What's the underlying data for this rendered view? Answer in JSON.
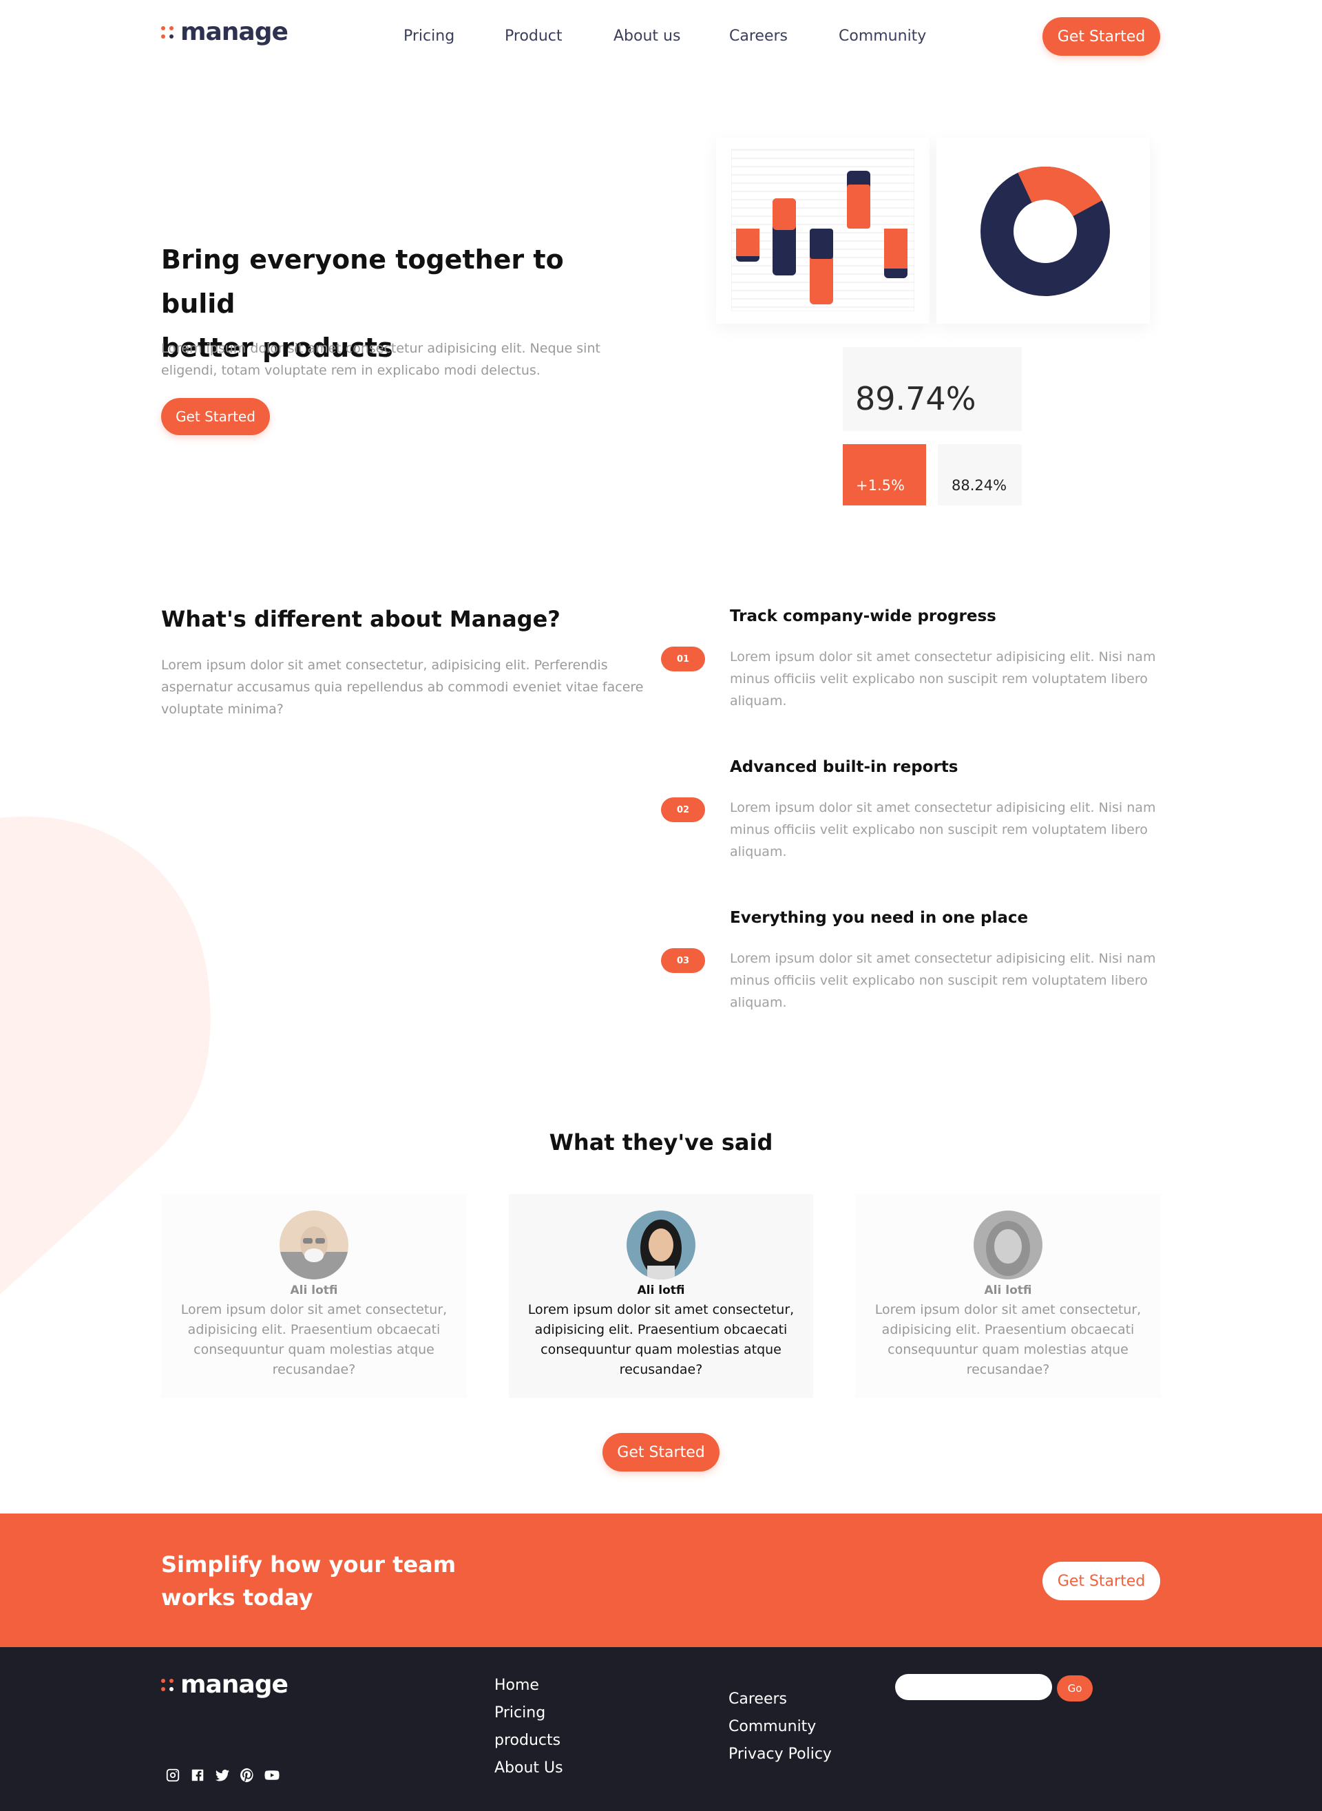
{
  "brand": {
    "name": "manage",
    "accent": "#f2603d",
    "dark": "#24294f"
  },
  "nav": {
    "links": [
      "Pricing",
      "Product",
      "About us",
      "Careers",
      "Community"
    ],
    "cta": "Get Started"
  },
  "hero": {
    "title_line1": "Bring everyone together to bulid",
    "title_line2": "better products",
    "text_line1": "Lorem ipsum dolor sit amet consectetur adipisicing elit. Neque sint",
    "text_line2": "eligendi, totam voluptate rem in explicabo modi delectus.",
    "cta": "Get Started"
  },
  "dashboard": {
    "main_stat": "89.74%",
    "change_stat": "+1.5%",
    "secondary_stat": "88.24%",
    "donut_fraction_orange": 0.24
  },
  "features": {
    "title": "What's different about Manage?",
    "intro_line1": "Lorem ipsum dolor sit amet consectetur, adipisicing elit. Perferendis",
    "intro_line2": "aspernatur accusamus quia repellendus ab commodi eveniet vitae facere",
    "intro_line3": "voluptate minima?",
    "items": [
      {
        "badge": "01",
        "title": "Track company-wide progress",
        "line1": "Lorem ipsum dolor sit amet consectetur adipisicing elit. Nisi nam",
        "line2": "minus officiis velit explicabo non suscipit rem voluptatem libero",
        "line3": "aliquam."
      },
      {
        "badge": "02",
        "title": "Advanced built-in reports",
        "line1": "Lorem ipsum dolor sit amet consectetur adipisicing elit. Nisi nam",
        "line2": "minus officiis velit explicabo non suscipit rem voluptatem libero",
        "line3": "aliquam."
      },
      {
        "badge": "03",
        "title": "Everything you need in one place",
        "line1": "Lorem ipsum dolor sit amet consectetur adipisicing elit. Nisi nam",
        "line2": "minus officiis velit explicabo non suscipit rem voluptatem libero",
        "line3": "aliquam."
      }
    ]
  },
  "testimonials": {
    "title": "What they've said",
    "items": [
      {
        "name": "Ali lotfi",
        "text": "Lorem ipsum dolor sit amet consectetur, adipisicing elit. Praesentium obcaecati consequuntur quam molestias atque recusandae?"
      },
      {
        "name": "Ali lotfi",
        "text": "Lorem ipsum dolor sit amet consectetur, adipisicing elit. Praesentium obcaecati consequuntur quam molestias atque recusandae?"
      },
      {
        "name": "Ali lotfi",
        "text": "Lorem ipsum dolor sit amet consectetur, adipisicing elit. Praesentium obcaecati consequuntur quam molestias atque recusandae?"
      }
    ],
    "cta": "Get Started"
  },
  "banner": {
    "line1": "Simplify how your team",
    "line2": "works today",
    "cta": "Get Started"
  },
  "footer": {
    "col1": [
      "Home",
      "Pricing",
      "products",
      "About Us"
    ],
    "col2": [
      "Careers",
      "Community",
      "Privacy Policy"
    ],
    "newsletter_button": "Go",
    "social_icons": [
      "instagram-icon",
      "facebook-icon",
      "twitter-icon",
      "pinterest-icon",
      "youtube-icon"
    ]
  }
}
